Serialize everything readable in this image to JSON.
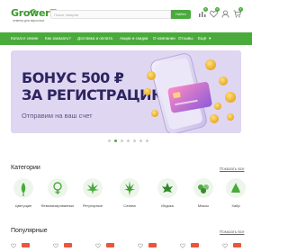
{
  "header": {
    "logo_main": "Grower",
    "logo_z": "Z",
    "logo_tagline": "семена для взрослых",
    "search_placeholder": "Поиск товаров",
    "search_button": "Найти",
    "icons": [
      "compare-icon",
      "heart-icon",
      "user-icon",
      "cart-icon"
    ],
    "badges": [
      "0",
      "0",
      "0"
    ]
  },
  "nav": {
    "items": [
      "Каталог семян",
      "Как заказать?",
      "Доставка и оплата",
      "Акции и скидки",
      "О компании",
      "Отзывы",
      "Ещё"
    ],
    "accent": "#4aab3c"
  },
  "banner": {
    "title_line1": "БОНУС 500 ₽",
    "title_line2": "ЗА РЕГИСТРАЦИЮ",
    "subtitle": "Отправим на ваш счет",
    "background": "#dfd6f1"
  },
  "carousel": {
    "count": 7,
    "active": 1
  },
  "categories": {
    "title": "Категории",
    "link": "Показать все",
    "items": [
      {
        "label": "Цветущие",
        "icon": "flower-icon"
      },
      {
        "label": "Феминизированные",
        "icon": "female-icon"
      },
      {
        "label": "Регулярные",
        "icon": "leaf-icon"
      },
      {
        "label": "Сатива",
        "icon": "sativa-icon"
      },
      {
        "label": "Индика",
        "icon": "indica-icon"
      },
      {
        "label": "Миксы",
        "icon": "mix-icon"
      },
      {
        "label": "Хайр",
        "icon": "hair-icon"
      }
    ]
  },
  "popular": {
    "title": "Популярные",
    "link": "Показать все"
  }
}
